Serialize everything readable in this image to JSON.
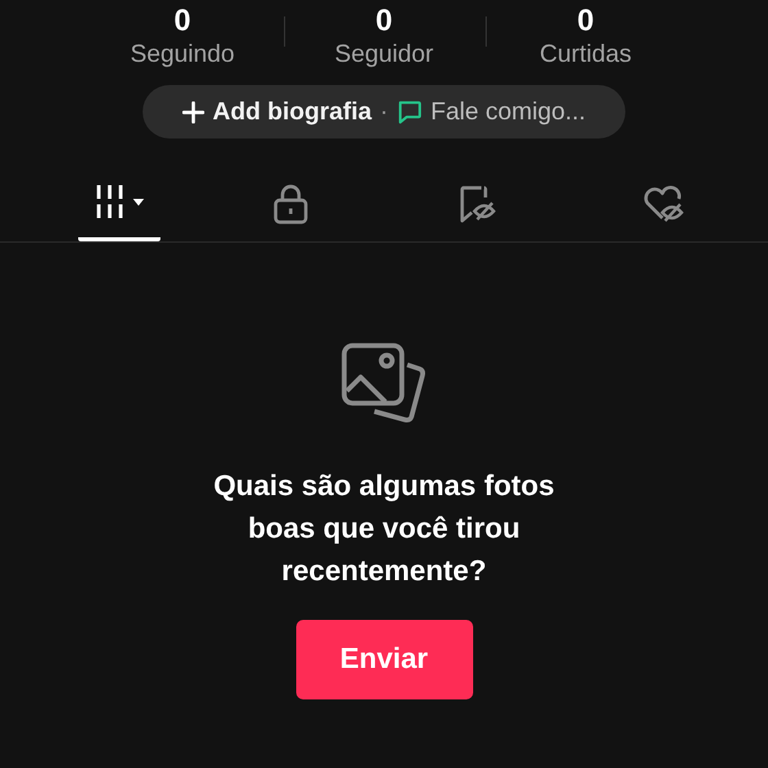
{
  "stats": [
    {
      "value": "0",
      "label": "Seguindo"
    },
    {
      "value": "0",
      "label": "Seguidor"
    },
    {
      "value": "0",
      "label": "Curtidas"
    }
  ],
  "bio_bar": {
    "add_label": "Add biografia",
    "separator": "·",
    "message_label": "Fale comigo..."
  },
  "tabs": [
    {
      "kind": "grid",
      "selected": true
    },
    {
      "kind": "lock",
      "selected": false
    },
    {
      "kind": "saved",
      "selected": false
    },
    {
      "kind": "liked",
      "selected": false
    }
  ],
  "empty_state": {
    "message": "Quais são algumas fotos boas que você tirou recentemente?",
    "button": "Enviar"
  }
}
